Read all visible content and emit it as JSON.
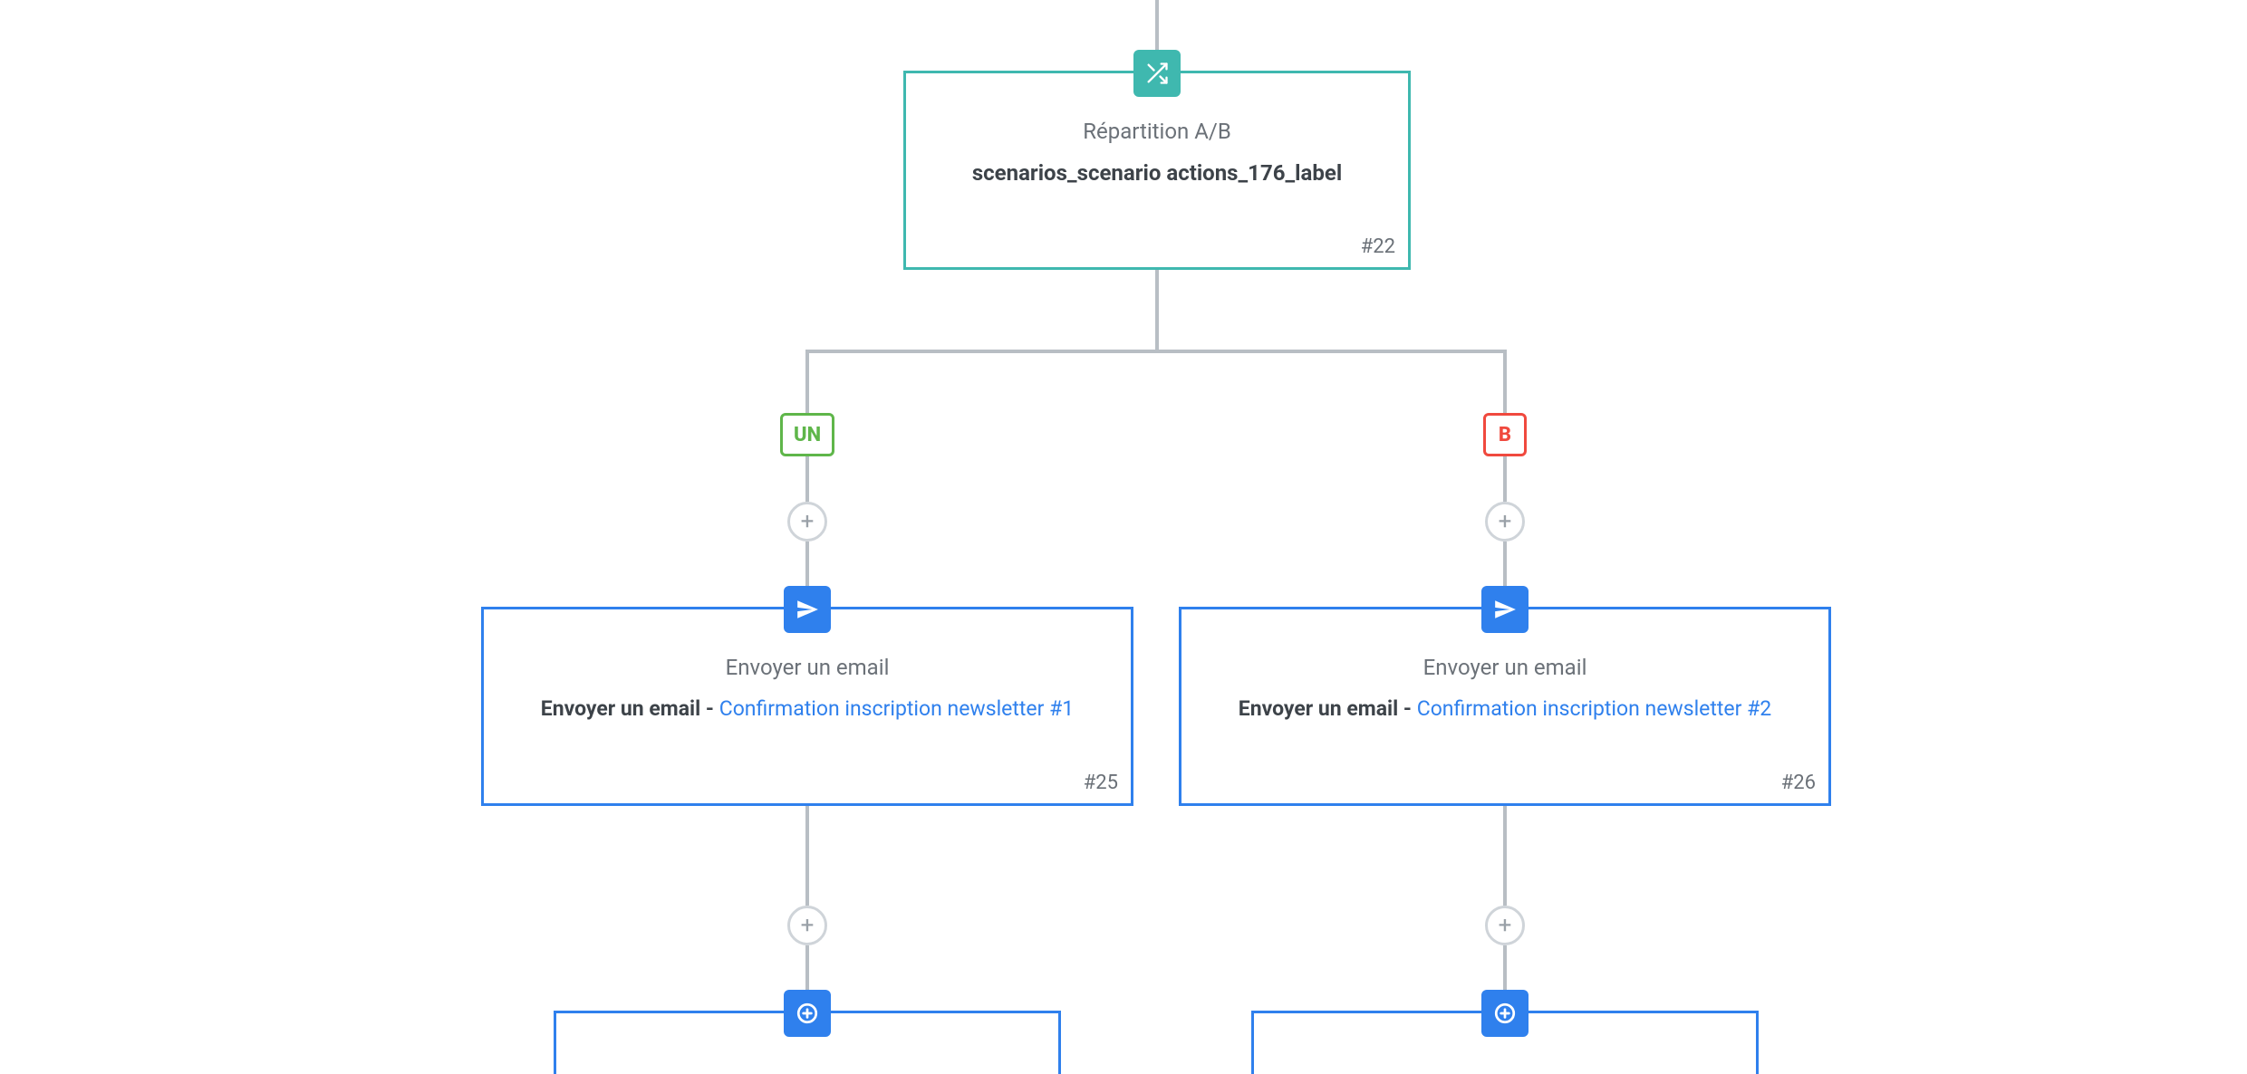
{
  "colors": {
    "teal": "#3fb8af",
    "blue": "#2f80ed",
    "green": "#5fb64a",
    "red": "#f0493e",
    "grayLine": "#b8bec4",
    "grayText": "#6b7178"
  },
  "split": {
    "title": "Répartition A/B",
    "label": "scenarios_scenario actions_176_label",
    "id": "#22",
    "iconName": "shuffle-icon"
  },
  "branches": {
    "a": {
      "badge": "UN"
    },
    "b": {
      "badge": "B"
    }
  },
  "emailLeft": {
    "title": "Envoyer un email",
    "labelBold": "Envoyer un email - ",
    "labelLink": "Confirmation inscription newsletter #1",
    "id": "#25",
    "iconName": "send-icon"
  },
  "emailRight": {
    "title": "Envoyer un email",
    "labelBold": "Envoyer un email - ",
    "labelLink": "Confirmation inscription newsletter #2",
    "id": "#26",
    "iconName": "send-icon"
  },
  "addButton": {
    "glyph": "+"
  },
  "terminalIconName": "plus-circle-icon"
}
